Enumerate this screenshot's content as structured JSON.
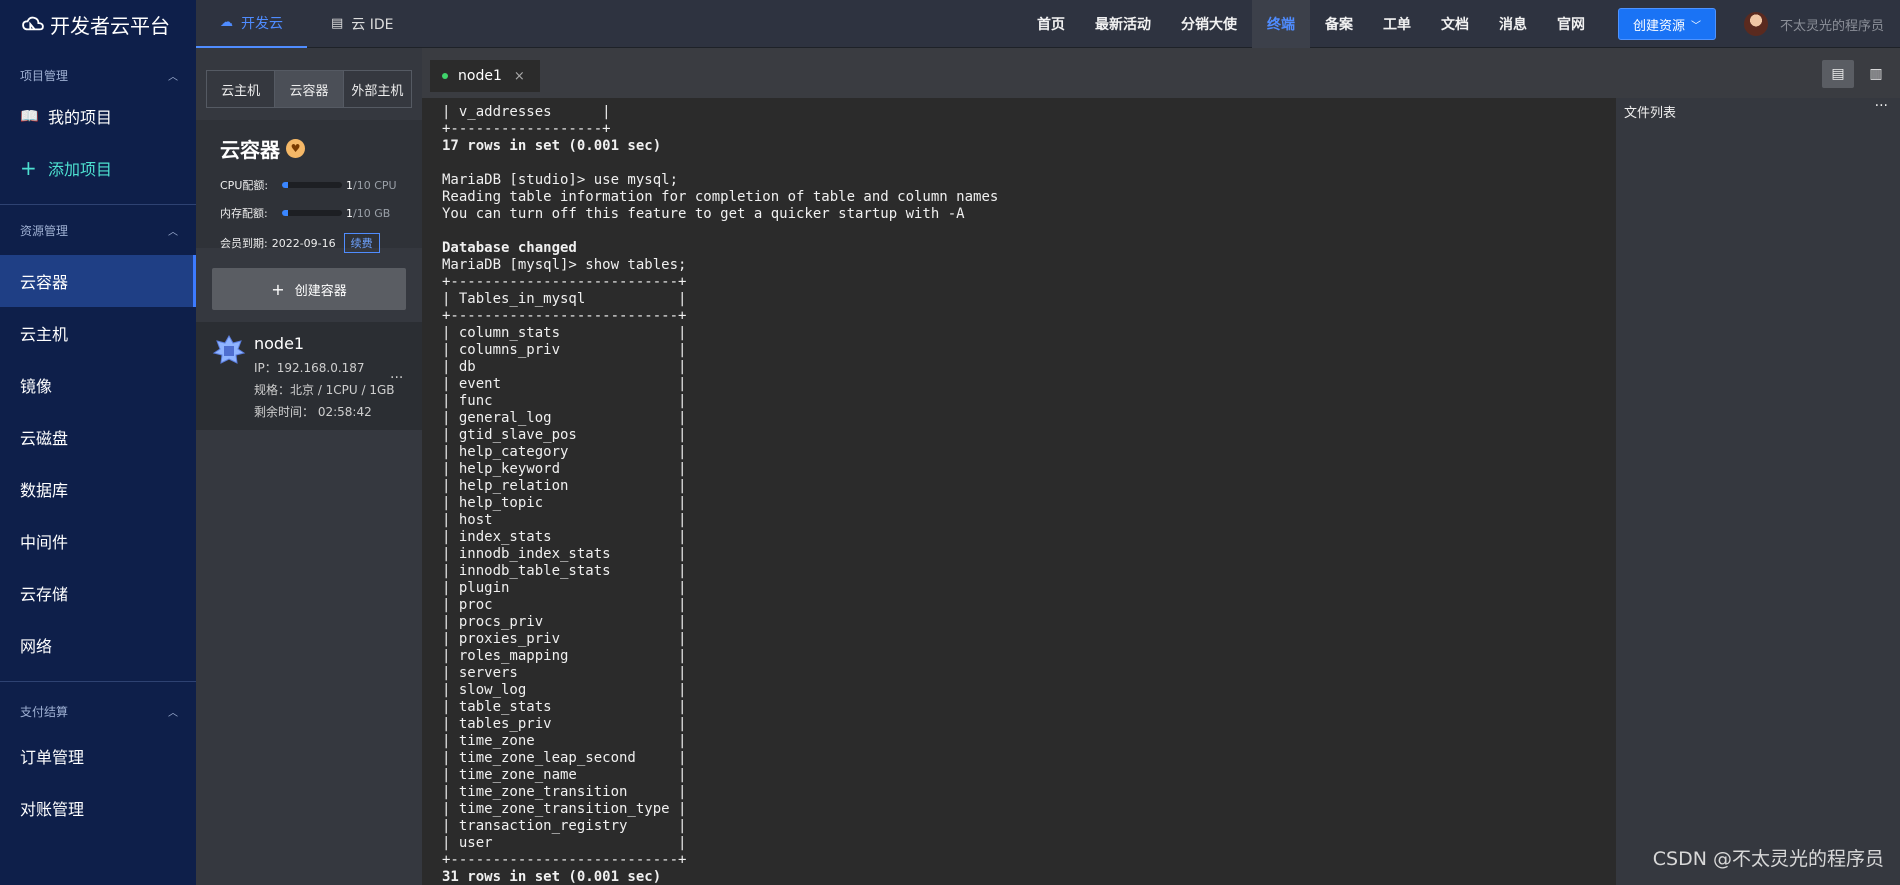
{
  "brand": {
    "title": "开发者云平台"
  },
  "sidebar": {
    "sections": [
      {
        "title": "项目管理",
        "items": [
          {
            "label": "我的项目",
            "icon": "book-icon"
          },
          {
            "label": "添加项目",
            "icon": "plus-icon"
          }
        ]
      },
      {
        "title": "资源管理",
        "items": [
          {
            "label": "云容器"
          },
          {
            "label": "云主机"
          },
          {
            "label": "镜像"
          },
          {
            "label": "云磁盘"
          },
          {
            "label": "数据库"
          },
          {
            "label": "中间件"
          },
          {
            "label": "云存储"
          },
          {
            "label": "网络"
          }
        ]
      },
      {
        "title": "支付结算",
        "items": [
          {
            "label": "订单管理"
          },
          {
            "label": "对账管理"
          }
        ]
      }
    ],
    "active_item": "云容器"
  },
  "topbar": {
    "tabs": [
      {
        "label": "开发云",
        "icon": "cloud-icon"
      },
      {
        "label": "云 IDE",
        "icon": "ide-icon"
      }
    ],
    "nav": [
      "首页",
      "最新活动",
      "分销大使",
      "终端",
      "备案",
      "工单",
      "文档",
      "消息",
      "官网"
    ],
    "active_nav": "终端",
    "create_button": "创建资源",
    "username": "不太灵光的程序员"
  },
  "panel": {
    "tabs": [
      "云主机",
      "云容器",
      "外部主机"
    ],
    "active_tab": "云容器",
    "title": "云容器",
    "cpu": {
      "label": "CPU配额:",
      "used": "1",
      "total": "/10 CPU",
      "fraction": 0.1
    },
    "mem": {
      "label": "内存配额:",
      "used": "1",
      "total": "/10 GB",
      "fraction": 0.1
    },
    "expire": {
      "label": "会员到期:",
      "value": "2022-09-16",
      "renew": "续费"
    },
    "add_button": "创建容器",
    "node": {
      "name": "node1",
      "ip": "IP：192.168.0.187",
      "spec": "规格：北京 / 1CPU / 1GB",
      "remaining": "剩余时间：  02:58:42"
    }
  },
  "terminal": {
    "tab": "node1",
    "lines": [
      "| v_addresses      |",
      "+------------------+",
      "17 rows in set (0.001 sec)",
      "",
      "MariaDB [studio]> use mysql;",
      "Reading table information for completion of table and column names",
      "You can turn off this feature to get a quicker startup with -A",
      "",
      "Database changed",
      "MariaDB [mysql]> show tables;",
      "+---------------------------+",
      "| Tables_in_mysql           |",
      "+---------------------------+",
      "| column_stats              |",
      "| columns_priv              |",
      "| db                        |",
      "| event                     |",
      "| func                      |",
      "| general_log               |",
      "| gtid_slave_pos            |",
      "| help_category             |",
      "| help_keyword              |",
      "| help_relation             |",
      "| help_topic                |",
      "| host                      |",
      "| index_stats               |",
      "| innodb_index_stats        |",
      "| innodb_table_stats        |",
      "| plugin                    |",
      "| proc                      |",
      "| procs_priv                |",
      "| proxies_priv              |",
      "| roles_mapping             |",
      "| servers                   |",
      "| slow_log                  |",
      "| table_stats               |",
      "| tables_priv               |",
      "| time_zone                 |",
      "| time_zone_leap_second     |",
      "| time_zone_name            |",
      "| time_zone_transition      |",
      "| time_zone_transition_type |",
      "| transaction_registry      |",
      "| user                      |",
      "+---------------------------+",
      "31 rows in set (0.001 sec)"
    ],
    "bold_lines": [
      2,
      8,
      45
    ]
  },
  "files": {
    "title": "文件列表"
  },
  "watermark": "CSDN @不太灵光的程序员",
  "colors": {
    "sidebar_bg": "#0e1f4a",
    "accent": "#1a73f5",
    "terminal_bg": "#2b2b2b"
  }
}
